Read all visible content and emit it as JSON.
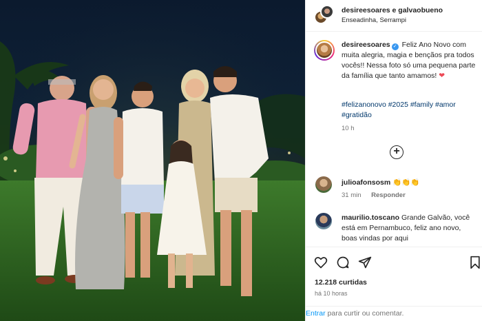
{
  "post": {
    "photo_alt": "",
    "header": {
      "username": "desireesoares e galvaobueno",
      "location": "Enseadinha, Serrampi"
    },
    "caption": {
      "username": "desireesoares",
      "text": "Feliz Ano Novo com muita alegria, magia e bençãos pra todos vocês!! Nessa foto só uma pequena parte da família que tanto amamos!",
      "hashtags": "#felizanonovo #2025 #family #amor #gratidão",
      "time": "10 h"
    },
    "comments": [
      {
        "username": "julioafonsosm",
        "text": "👏👏👏",
        "time": "31 min",
        "reply": "Responder"
      },
      {
        "username": "maurilio.toscano",
        "text": "Grande Galvão, você está em Pernambuco, feliz ano novo, boas vindas por aqui"
      }
    ],
    "likes": "12.218 curtidas",
    "posted": "há 10 horas",
    "footer": {
      "login_link": "Entrar",
      "rest": "para curtir ou comentar."
    }
  },
  "colors": {
    "link": "#00376b",
    "login": "#0095f6",
    "verified": "#3897f0",
    "heart": "#ed4956"
  },
  "icons": [
    "heart-icon",
    "comment-icon",
    "share-icon",
    "bookmark-icon",
    "add-circle-icon",
    "verified-icon"
  ]
}
